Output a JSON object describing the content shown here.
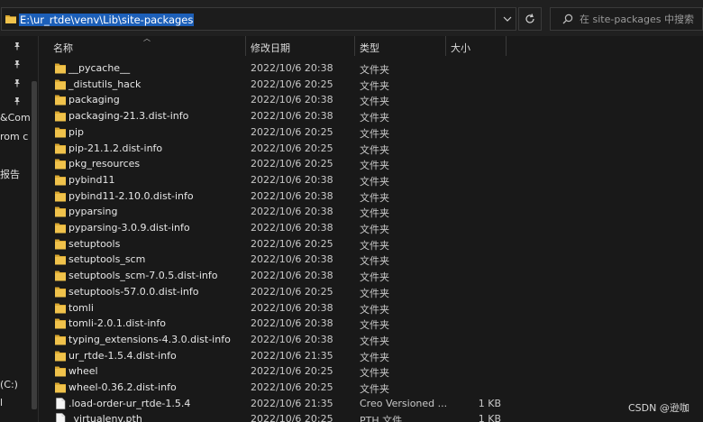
{
  "address_bar": {
    "path": "E:\\ur_rtde\\venv\\Lib\\site-packages",
    "dropdown_icon": "chevron-down-icon",
    "refresh_icon": "refresh-icon"
  },
  "search": {
    "placeholder": "在 site-packages 中搜索",
    "icon": "search-icon"
  },
  "nav_pane": {
    "pin_icon": "pin-icon",
    "pins": 4,
    "partial_labels": [
      "&Com",
      "rom c",
      "报告",
      "(C:)",
      "l"
    ]
  },
  "columns": {
    "name": "名称",
    "modified": "修改日期",
    "type": "类型",
    "size": "大小"
  },
  "files": [
    {
      "name": "__pycache__",
      "modified": "2022/10/6 20:38",
      "type": "文件夹",
      "size": "",
      "kind": "folder"
    },
    {
      "name": "_distutils_hack",
      "modified": "2022/10/6 20:25",
      "type": "文件夹",
      "size": "",
      "kind": "folder"
    },
    {
      "name": "packaging",
      "modified": "2022/10/6 20:38",
      "type": "文件夹",
      "size": "",
      "kind": "folder"
    },
    {
      "name": "packaging-21.3.dist-info",
      "modified": "2022/10/6 20:38",
      "type": "文件夹",
      "size": "",
      "kind": "folder"
    },
    {
      "name": "pip",
      "modified": "2022/10/6 20:25",
      "type": "文件夹",
      "size": "",
      "kind": "folder"
    },
    {
      "name": "pip-21.1.2.dist-info",
      "modified": "2022/10/6 20:25",
      "type": "文件夹",
      "size": "",
      "kind": "folder"
    },
    {
      "name": "pkg_resources",
      "modified": "2022/10/6 20:25",
      "type": "文件夹",
      "size": "",
      "kind": "folder"
    },
    {
      "name": "pybind11",
      "modified": "2022/10/6 20:38",
      "type": "文件夹",
      "size": "",
      "kind": "folder"
    },
    {
      "name": "pybind11-2.10.0.dist-info",
      "modified": "2022/10/6 20:38",
      "type": "文件夹",
      "size": "",
      "kind": "folder"
    },
    {
      "name": "pyparsing",
      "modified": "2022/10/6 20:38",
      "type": "文件夹",
      "size": "",
      "kind": "folder"
    },
    {
      "name": "pyparsing-3.0.9.dist-info",
      "modified": "2022/10/6 20:38",
      "type": "文件夹",
      "size": "",
      "kind": "folder"
    },
    {
      "name": "setuptools",
      "modified": "2022/10/6 20:25",
      "type": "文件夹",
      "size": "",
      "kind": "folder"
    },
    {
      "name": "setuptools_scm",
      "modified": "2022/10/6 20:38",
      "type": "文件夹",
      "size": "",
      "kind": "folder"
    },
    {
      "name": "setuptools_scm-7.0.5.dist-info",
      "modified": "2022/10/6 20:38",
      "type": "文件夹",
      "size": "",
      "kind": "folder"
    },
    {
      "name": "setuptools-57.0.0.dist-info",
      "modified": "2022/10/6 20:25",
      "type": "文件夹",
      "size": "",
      "kind": "folder"
    },
    {
      "name": "tomli",
      "modified": "2022/10/6 20:38",
      "type": "文件夹",
      "size": "",
      "kind": "folder"
    },
    {
      "name": "tomli-2.0.1.dist-info",
      "modified": "2022/10/6 20:38",
      "type": "文件夹",
      "size": "",
      "kind": "folder"
    },
    {
      "name": "typing_extensions-4.3.0.dist-info",
      "modified": "2022/10/6 20:38",
      "type": "文件夹",
      "size": "",
      "kind": "folder"
    },
    {
      "name": "ur_rtde-1.5.4.dist-info",
      "modified": "2022/10/6 21:35",
      "type": "文件夹",
      "size": "",
      "kind": "folder"
    },
    {
      "name": "wheel",
      "modified": "2022/10/6 20:25",
      "type": "文件夹",
      "size": "",
      "kind": "folder"
    },
    {
      "name": "wheel-0.36.2.dist-info",
      "modified": "2022/10/6 20:25",
      "type": "文件夹",
      "size": "",
      "kind": "folder"
    },
    {
      "name": ".load-order-ur_rtde-1.5.4",
      "modified": "2022/10/6 21:35",
      "type": "Creo Versioned ...",
      "size": "1 KB",
      "kind": "file"
    },
    {
      "name": "_virtualenv.pth",
      "modified": "2022/10/6 20:25",
      "type": "PTH 文件",
      "size": "1 KB",
      "kind": "file"
    }
  ],
  "watermark": "CSDN @逊咖",
  "colors": {
    "background": "#191919",
    "selection": "#1c5fb8",
    "folder": "#e8b93c"
  }
}
